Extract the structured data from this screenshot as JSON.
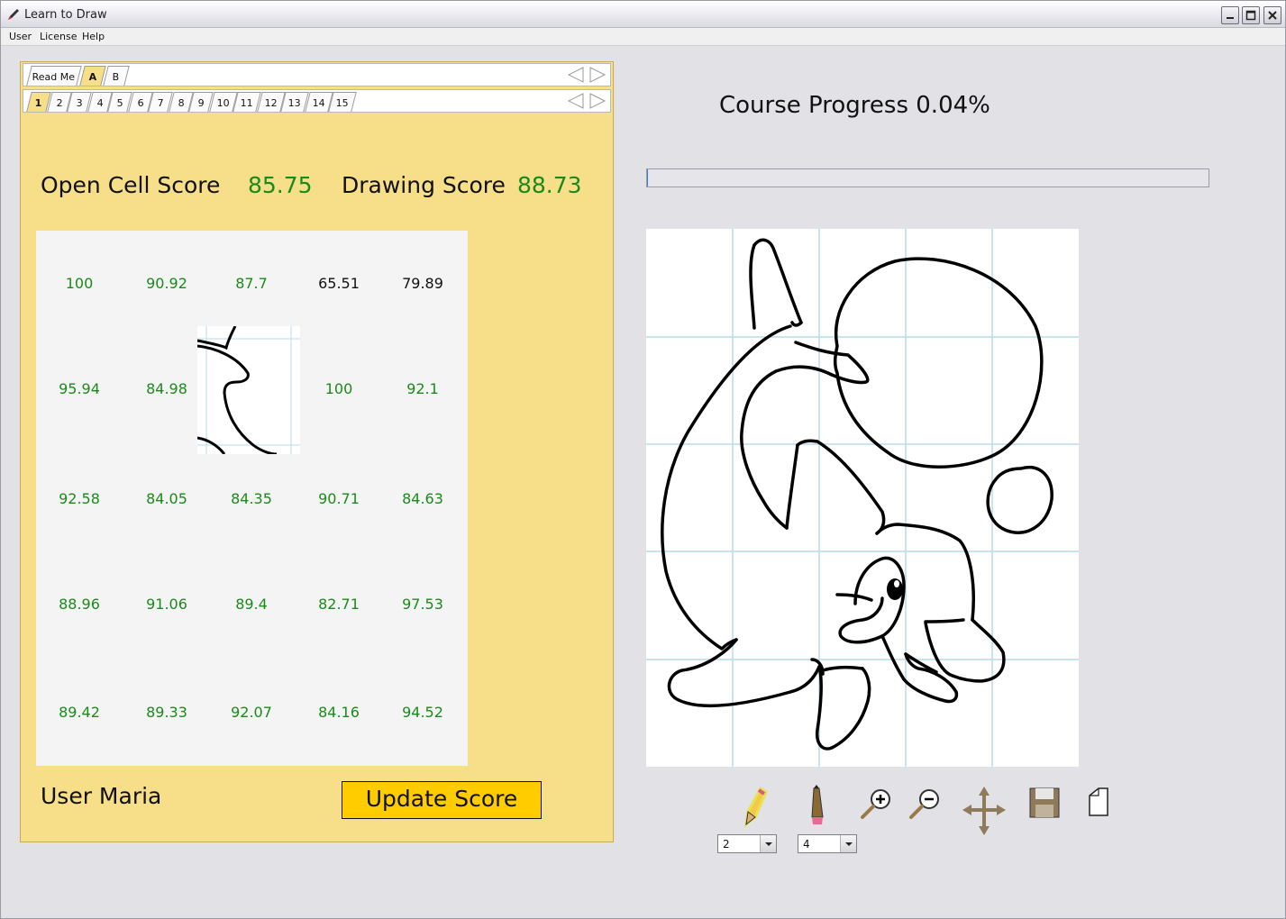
{
  "window": {
    "title": "Learn to Draw"
  },
  "menu": {
    "items": [
      "User",
      "License",
      "Help"
    ]
  },
  "outer_tabs": [
    {
      "label": "Read Me",
      "active": false
    },
    {
      "label": "A",
      "active": true
    },
    {
      "label": "B",
      "active": false
    }
  ],
  "inner_tabs": [
    {
      "label": "1",
      "active": true
    },
    {
      "label": "2",
      "active": false
    },
    {
      "label": "3",
      "active": false
    },
    {
      "label": "4",
      "active": false
    },
    {
      "label": "5",
      "active": false
    },
    {
      "label": "6",
      "active": false
    },
    {
      "label": "7",
      "active": false
    },
    {
      "label": "8",
      "active": false
    },
    {
      "label": "9",
      "active": false
    },
    {
      "label": "10",
      "active": false
    },
    {
      "label": "11",
      "active": false
    },
    {
      "label": "12",
      "active": false
    },
    {
      "label": "13",
      "active": false
    },
    {
      "label": "14",
      "active": false
    },
    {
      "label": "15",
      "active": false
    }
  ],
  "scores": {
    "open_cell_label": "Open Cell Score",
    "open_cell_value": "85.75",
    "drawing_label": "Drawing Score",
    "drawing_value": "88.73"
  },
  "cell_grid": [
    [
      "100",
      "90.92",
      "87.7",
      "65.51",
      "79.89"
    ],
    [
      "95.94",
      "84.98",
      "",
      "100",
      "92.1"
    ],
    [
      "92.58",
      "84.05",
      "84.35",
      "90.71",
      "84.63"
    ],
    [
      "88.96",
      "91.06",
      "89.4",
      "82.71",
      "97.53"
    ],
    [
      "89.42",
      "89.33",
      "92.07",
      "84.16",
      "94.52"
    ]
  ],
  "cell_colors": [
    [
      "green",
      "green",
      "green",
      "black",
      "black"
    ],
    [
      "green",
      "green",
      "none",
      "green",
      "green"
    ],
    [
      "green",
      "green",
      "green",
      "green",
      "green"
    ],
    [
      "green",
      "green",
      "green",
      "green",
      "green"
    ],
    [
      "green",
      "green",
      "green",
      "green",
      "green"
    ]
  ],
  "user": {
    "label": "User Maria"
  },
  "update_button": {
    "label": "Update Score"
  },
  "progress": {
    "label": "Course Progress 0.04%",
    "percent": 0.04
  },
  "tools": {
    "pen_size": "2",
    "pencil_size": "4",
    "icons": [
      "pen-icon",
      "pencil-icon",
      "zoom-in-icon",
      "zoom-out-icon",
      "move-icon",
      "save-icon",
      "new-page-icon"
    ]
  },
  "colors": {
    "panel": "#f7de89",
    "score_green": "#1a8a1a",
    "button": "#ffcc00",
    "grid_line": "#b9dcea"
  }
}
